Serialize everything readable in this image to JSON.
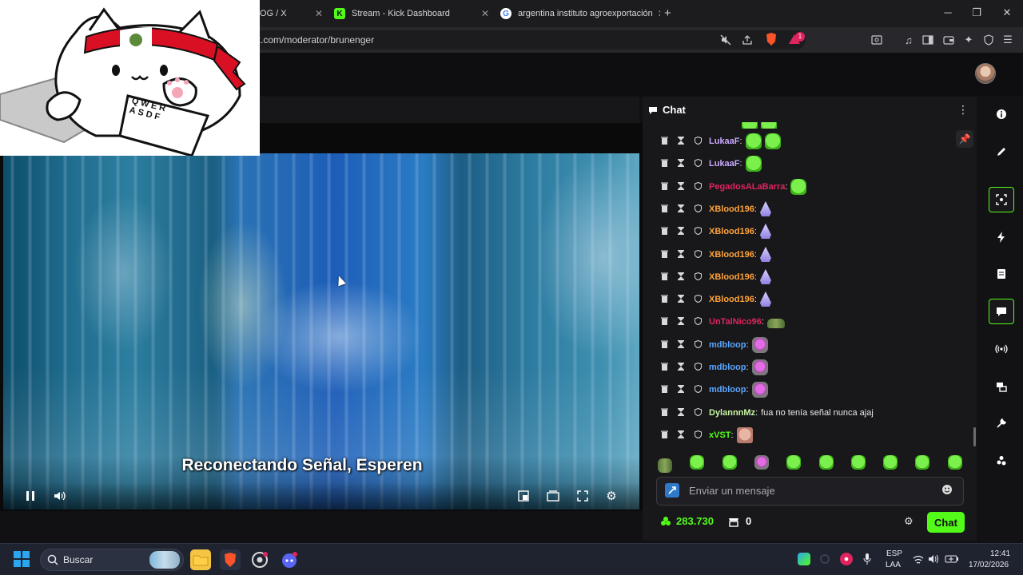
{
  "browser": {
    "tabs": [
      {
        "label": "OG / X",
        "favicon": "x-logo"
      },
      {
        "label": "Stream - Kick Dashboard",
        "favicon": "kick-logo"
      },
      {
        "label": "argentina instituto agroexportación",
        "favicon": "google-logo"
      }
    ],
    "new_tab": "+",
    "url": "ck.com/moderator/brunenger",
    "window_controls": {
      "minimize": "─",
      "maximize": "❐",
      "close": "✕"
    },
    "brave_badge": "1"
  },
  "video": {
    "caption": "Reconectando Señal, Esperen"
  },
  "overlay": {
    "keyboard_keys": [
      "Q",
      "W",
      "E",
      "R",
      "A",
      "S",
      "D",
      "F"
    ]
  },
  "chat": {
    "title": "Chat",
    "messages": [
      {
        "user": "LukaaF",
        "color": "#c9a7ff",
        "emotes": [
          "green",
          "green"
        ],
        "text": ""
      },
      {
        "user": "LukaaF",
        "color": "#c9a7ff",
        "emotes": [
          "green"
        ],
        "text": ""
      },
      {
        "user": "PegadosALaBarra",
        "color": "#e0245e",
        "emotes": [
          "green"
        ],
        "text": ""
      },
      {
        "user": "XBlood196",
        "color": "#ffa239",
        "emotes": [
          "drop"
        ],
        "text": ""
      },
      {
        "user": "XBlood196",
        "color": "#ffa239",
        "emotes": [
          "drop"
        ],
        "text": ""
      },
      {
        "user": "XBlood196",
        "color": "#ffa239",
        "emotes": [
          "drop"
        ],
        "text": ""
      },
      {
        "user": "XBlood196",
        "color": "#ffa239",
        "emotes": [
          "drop"
        ],
        "text": ""
      },
      {
        "user": "XBlood196",
        "color": "#ffa239",
        "emotes": [
          "drop"
        ],
        "text": ""
      },
      {
        "user": "UnTalNico96",
        "color": "#e0245e",
        "emotes": [
          "frog"
        ],
        "text": ""
      },
      {
        "user": "mdbloop",
        "color": "#5aa6ff",
        "emotes": [
          "purple"
        ],
        "text": ""
      },
      {
        "user": "mdbloop",
        "color": "#5aa6ff",
        "emotes": [
          "purple"
        ],
        "text": ""
      },
      {
        "user": "mdbloop",
        "color": "#5aa6ff",
        "emotes": [
          "purple"
        ],
        "text": ""
      },
      {
        "user": "DylannnMz",
        "color": "#c8f7a1",
        "emotes": [],
        "text": "fua no tenía señal nunca ajaj"
      },
      {
        "user": "xVST",
        "color": "#53fc18",
        "emotes": [
          "face"
        ],
        "text": ""
      }
    ],
    "input_placeholder": "Enviar un mensaje",
    "points": "283.730",
    "store_count": "0",
    "send_label": "Chat",
    "accent": "#53fc18"
  },
  "taskbar": {
    "search_placeholder": "Buscar",
    "language_top": "ESP",
    "language_bottom": "LAA",
    "time": "12:41",
    "date": "17/02/2026"
  }
}
